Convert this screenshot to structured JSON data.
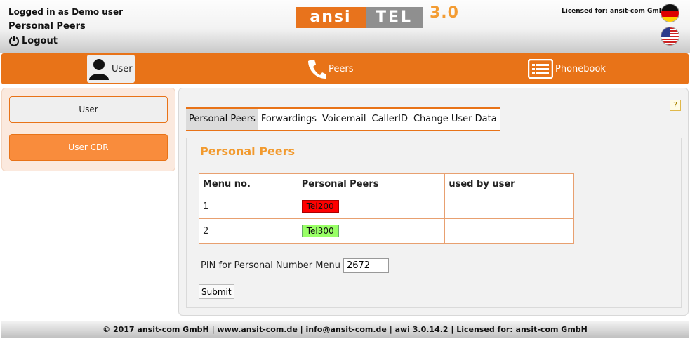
{
  "header": {
    "logged_in": "Logged in as Demo user",
    "title": "Personal Peers",
    "logout": "Logout",
    "logo_part1": "ansi",
    "logo_part2": "TEL",
    "logo_version": "3.0",
    "licensed": "Licensed for: ansit-com GmbH",
    "flags": [
      "german-flag-icon",
      "us-flag-icon"
    ]
  },
  "nav": {
    "user": "User",
    "peers": "Peers",
    "phonebook": "Phonebook"
  },
  "sidebar": {
    "items": [
      {
        "label": "User",
        "active": false
      },
      {
        "label": "User CDR",
        "active": true
      }
    ]
  },
  "help": "?",
  "tabs": [
    {
      "label": "Personal Peers",
      "active": true
    },
    {
      "label": "Forwardings",
      "active": false
    },
    {
      "label": "Voicemail",
      "active": false
    },
    {
      "label": "CallerID",
      "active": false
    },
    {
      "label": "Change User Data",
      "active": false
    }
  ],
  "content": {
    "title": "Personal Peers",
    "table": {
      "headers": [
        "Menu no.",
        "Personal Peers",
        "used by user"
      ],
      "rows": [
        {
          "menu_no": "1",
          "peer": "Tel200",
          "peer_status_color": "#ff0000",
          "used_by": ""
        },
        {
          "menu_no": "2",
          "peer": "Tel300",
          "peer_status_color": "#99ff66",
          "used_by": ""
        }
      ]
    },
    "pin_label": "PIN for Personal Number Menu",
    "pin_value": "2672",
    "submit": "Submit"
  },
  "footer": "© 2017 ansit-com GmbH | www.ansit-com.de | info@ansit-com.de | awi 3.0.14.2 | Licensed for: ansit-com GmbH",
  "colors": {
    "accent": "#e87318",
    "sidebar_active": "#f98c3c",
    "title_orange": "#f29a2e"
  }
}
